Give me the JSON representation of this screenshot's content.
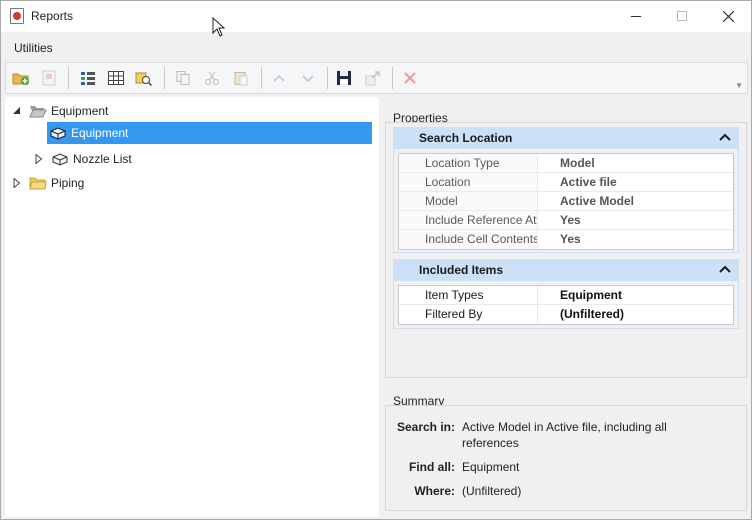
{
  "window": {
    "title": "Reports",
    "icon": "reports-app-icon",
    "controls": [
      "minimize-icon",
      "maximize-icon",
      "close-icon"
    ]
  },
  "menu": {
    "items": [
      {
        "label": "Utilities"
      }
    ]
  },
  "toolbar": {
    "buttons": [
      {
        "icon": "add-folder-icon",
        "enabled": true
      },
      {
        "icon": "add-report-icon",
        "enabled": false
      },
      {
        "icon": "item-types-icon",
        "enabled": true
      },
      {
        "icon": "columns-grid-icon",
        "enabled": true
      },
      {
        "icon": "search-location-icon",
        "enabled": true
      },
      {
        "icon": "copy-icon",
        "enabled": false
      },
      {
        "icon": "cut-icon",
        "enabled": false
      },
      {
        "icon": "paste-icon",
        "enabled": false
      },
      {
        "icon": "move-up-icon",
        "enabled": false
      },
      {
        "icon": "move-down-icon",
        "enabled": false
      },
      {
        "icon": "save-icon",
        "enabled": true
      },
      {
        "icon": "export-icon",
        "enabled": false
      },
      {
        "icon": "delete-icon",
        "enabled": false
      }
    ]
  },
  "tree": {
    "nodes": [
      {
        "label": "Equipment",
        "level": 0,
        "expanded": true,
        "icon": "folder-open-icon",
        "selected": false
      },
      {
        "label": "Equipment",
        "level": 1,
        "expanded": false,
        "icon": "report-icon",
        "selected": true
      },
      {
        "label": "Nozzle List",
        "level": 1,
        "expanded": false,
        "icon": "report-icon",
        "selected": false
      },
      {
        "label": "Piping",
        "level": 0,
        "expanded": false,
        "icon": "folder-icon",
        "selected": false
      }
    ]
  },
  "properties": {
    "label": "Properties",
    "search_location": {
      "header": "Search Location",
      "rows": [
        {
          "key": "Location Type",
          "value": "Model"
        },
        {
          "key": "Location",
          "value": "Active file"
        },
        {
          "key": "Model",
          "value": "Active Model"
        },
        {
          "key": "Include Reference Attach",
          "value": "Yes"
        },
        {
          "key": "Include Cell Contents",
          "value": "Yes"
        }
      ]
    },
    "included_items": {
      "header": "Included Items",
      "rows": [
        {
          "key": "Item Types",
          "value": "Equipment"
        },
        {
          "key": "Filtered By",
          "value": "(Unfiltered)"
        }
      ]
    }
  },
  "summary": {
    "label": "Summary",
    "search_in_label": "Search in:",
    "search_in_value": "Active Model  in Active file, including all references",
    "find_all_label": "Find all:",
    "find_all_value": "Equipment",
    "where_label": "Where:",
    "where_value": "(Unfiltered)"
  },
  "colors": {
    "selection": "#3399f0",
    "section_header": "#cce0f7",
    "folder": "#e8b94a"
  }
}
